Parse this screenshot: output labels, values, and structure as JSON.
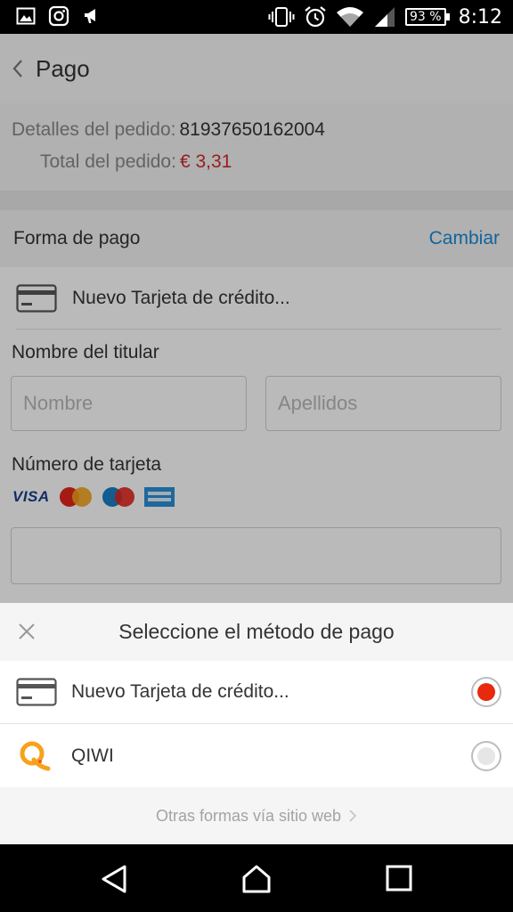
{
  "status_bar": {
    "battery": "93 %",
    "time": "8:12"
  },
  "header": {
    "title": "Pago"
  },
  "order": {
    "details_label": "Detalles del pedido:",
    "details_value": "81937650162004",
    "total_label": "Total del pedido:",
    "total_value": "€ 3,31"
  },
  "payment_method": {
    "label": "Forma de pago",
    "change_link": "Cambiar",
    "card_label": "Nuevo Tarjeta de crédito..."
  },
  "form": {
    "holder_label": "Nombre del titular",
    "first_name_placeholder": "Nombre",
    "last_name_placeholder": "Apellidos",
    "card_number_label": "Número de tarjeta",
    "card_number_value": "",
    "brands": [
      "VISA",
      "MasterCard",
      "Maestro",
      "AmericanExpress"
    ]
  },
  "sheet": {
    "title": "Seleccione el método de pago",
    "options": [
      {
        "label": "Nuevo Tarjeta de crédito...",
        "selected": true,
        "icon": "credit-card-icon"
      },
      {
        "label": "QIWI",
        "selected": false,
        "icon": "qiwi-logo-icon"
      }
    ],
    "other_link": "Otras formas vía sitio web"
  },
  "colors": {
    "accent_blue": "#1a8ad6",
    "price_red": "#d4282c",
    "radio_selected": "#e8290d"
  }
}
